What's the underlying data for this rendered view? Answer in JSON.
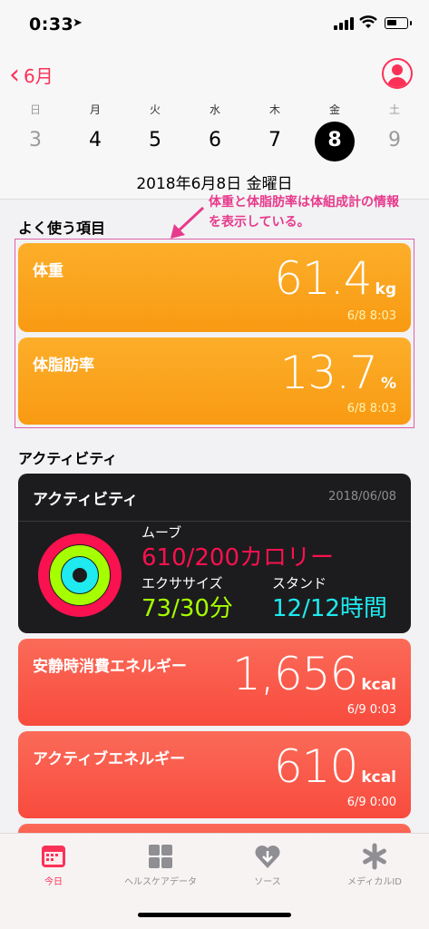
{
  "status": {
    "time": "0:33"
  },
  "header": {
    "back_label": "6月",
    "weekdays": [
      "日",
      "月",
      "火",
      "水",
      "木",
      "金",
      "土"
    ],
    "days": [
      "3",
      "4",
      "5",
      "6",
      "7",
      "8",
      "9"
    ],
    "selected_day": "8",
    "date_full": "2018年6月8日 金曜日"
  },
  "favorites": {
    "title": "よく使う項目",
    "annotation": "体重と体脂肪率は体組成計の情報を表示している。",
    "cards": [
      {
        "title": "体重",
        "value": "61.4",
        "unit": "kg",
        "timestamp": "6/8 8:03"
      },
      {
        "title": "体脂肪率",
        "value": "13.7",
        "unit": "%",
        "timestamp": "6/8 8:03"
      }
    ]
  },
  "activity": {
    "section_title": "アクティビティ",
    "card_title": "アクティビティ",
    "date": "2018/06/08",
    "move_label": "ムーブ",
    "move_value": "610/200カロリー",
    "exercise_label": "エクササイズ",
    "exercise_value": "73/30分",
    "stand_label": "スタンド",
    "stand_value": "12/12時間"
  },
  "energy_cards": [
    {
      "title": "安静時消費エネルギー",
      "value": "1,656",
      "unit": "kcal",
      "timestamp": "6/9 0:03"
    },
    {
      "title": "アクティブエネルギー",
      "value": "610",
      "unit": "kcal",
      "timestamp": "6/9 0:00"
    }
  ],
  "tabs": [
    {
      "label": "今日",
      "icon": "calendar-icon"
    },
    {
      "label": "ヘルスケアデータ",
      "icon": "grid-icon"
    },
    {
      "label": "ソース",
      "icon": "heart-download-icon"
    },
    {
      "label": "メディカルID",
      "icon": "asterisk-icon"
    }
  ],
  "colors": {
    "accent": "#fc3158",
    "orange": "#fca520",
    "red": "#fa5a4a",
    "move": "#fa114f",
    "exercise": "#a6ff00",
    "stand": "#1eeaef"
  }
}
